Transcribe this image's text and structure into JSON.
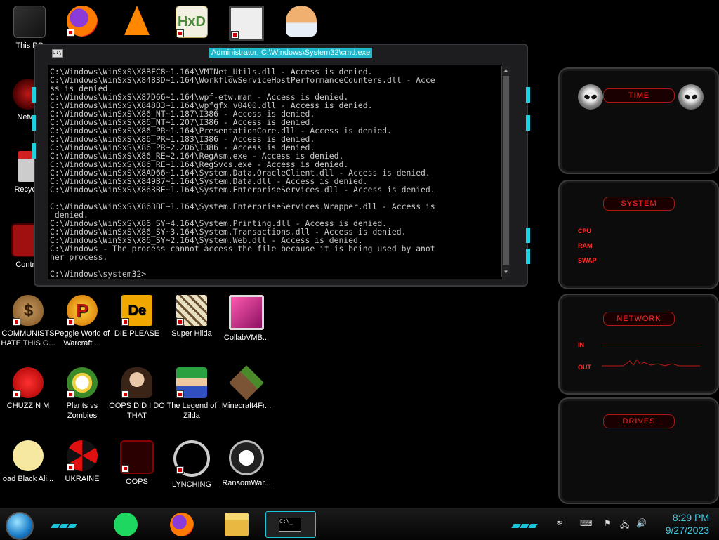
{
  "desktop": {
    "icons_top": [
      {
        "label": "This PC",
        "icon": "this-pc-icon"
      },
      {
        "label": "",
        "icon": "firefox-icon"
      },
      {
        "label": "",
        "icon": "vlc-icon"
      },
      {
        "label": "",
        "icon": "hxd-icon"
      },
      {
        "label": "",
        "icon": "app-icon"
      },
      {
        "label": "",
        "icon": "doctor-icon"
      }
    ],
    "icons_left": [
      {
        "label": "Netwo",
        "icon": "network-icon"
      },
      {
        "label": "Recycle",
        "icon": "recycle-bin-icon"
      },
      {
        "label": "Control",
        "icon": "control-panel-icon"
      }
    ],
    "row1": [
      {
        "label": "COMMUNISTS HATE THIS G...",
        "icon": "money-bag-icon"
      },
      {
        "label": "Peggle World of Warcraft ...",
        "icon": "peggle-icon"
      },
      {
        "label": "DIE PLEASE",
        "icon": "die-icon"
      },
      {
        "label": "Super Hilda",
        "icon": "super-hilda-icon"
      },
      {
        "label": "CollabVMB...",
        "icon": "collabvm-icon"
      }
    ],
    "row2": [
      {
        "label": "CHUZZIN M",
        "icon": "chuzzle-icon"
      },
      {
        "label": "Plants vs Zombies",
        "icon": "pvz-icon"
      },
      {
        "label": "OOPS DID I DO THAT",
        "icon": "portrait-icon"
      },
      {
        "label": "The Legend of Zilda",
        "icon": "zilda-icon"
      },
      {
        "label": "Minecraft4Fr...",
        "icon": "minecraft-icon"
      }
    ],
    "row3": [
      {
        "label": "oad Black Ali...",
        "icon": "star-character-icon"
      },
      {
        "label": "UKRAINE",
        "icon": "radiation-icon"
      },
      {
        "label": "OOPS",
        "icon": "oops-icon"
      },
      {
        "label": "LYNCHING",
        "icon": "lynching-icon"
      },
      {
        "label": "RansomWar...",
        "icon": "skull-icon"
      }
    ]
  },
  "cmd": {
    "title": "Administrator: C:\\Windows\\System32\\cmd.exe",
    "output": "C:\\Windows\\WinSxS\\X8BFC8~1.164\\VMINet_Utils.dll - Access is denied.\nC:\\Windows\\WinSxS\\X8483D~1.164\\WorkflowServiceHostPerformanceCounters.dll - Acce\nss is denied.\nC:\\Windows\\WinSxS\\X87D66~1.164\\wpf-etw.man - Access is denied.\nC:\\Windows\\WinSxS\\X848B3~1.164\\wpfgfx_v0400.dll - Access is denied.\nC:\\Windows\\WinSxS\\X86_NT~1.187\\I386 - Access is denied.\nC:\\Windows\\WinSxS\\X86_NT~1.207\\I386 - Access is denied.\nC:\\Windows\\WinSxS\\X86_PR~1.164\\PresentationCore.dll - Access is denied.\nC:\\Windows\\WinSxS\\X86_PR~1.183\\I386 - Access is denied.\nC:\\Windows\\WinSxS\\X86_PR~2.206\\I386 - Access is denied.\nC:\\Windows\\WinSxS\\X86_RE~2.164\\RegAsm.exe - Access is denied.\nC:\\Windows\\WinSxS\\X86_RE~1.164\\RegSvcs.exe - Access is denied.\nC:\\Windows\\WinSxS\\X8AD66~1.164\\System.Data.OracleClient.dll - Access is denied.\nC:\\Windows\\WinSxS\\X849B7~1.164\\System.Data.dll - Access is denied.\nC:\\Windows\\WinSxS\\X863BE~1.164\\System.EnterpriseServices.dll - Access is denied.\n\nC:\\Windows\\WinSxS\\X863BE~1.164\\System.EnterpriseServices.Wrapper.dll - Access is\n denied.\nC:\\Windows\\WinSxS\\X86_SY~4.164\\System.Printing.dll - Access is denied.\nC:\\Windows\\WinSxS\\X86_SY~3.164\\System.Transactions.dll - Access is denied.\nC:\\Windows\\WinSxS\\X86_SY~2.164\\System.Web.dll - Access is denied.\nC:\\Windows - The process cannot access the file because it is being used by anot\nher process.\n\nC:\\Windows\\system32>"
  },
  "gadgets": {
    "time": {
      "title": "TIME"
    },
    "system": {
      "title": "SYSTEM",
      "cpu": "CPU",
      "ram": "RAM",
      "swap": "SWAP"
    },
    "network": {
      "title": "NETWORK",
      "in": "IN",
      "out": "OUT"
    },
    "drives": {
      "title": "DRIVES"
    }
  },
  "taskbar": {
    "time": "8:29 PM",
    "date": "9/27/2023",
    "accent": "#19c6da"
  }
}
